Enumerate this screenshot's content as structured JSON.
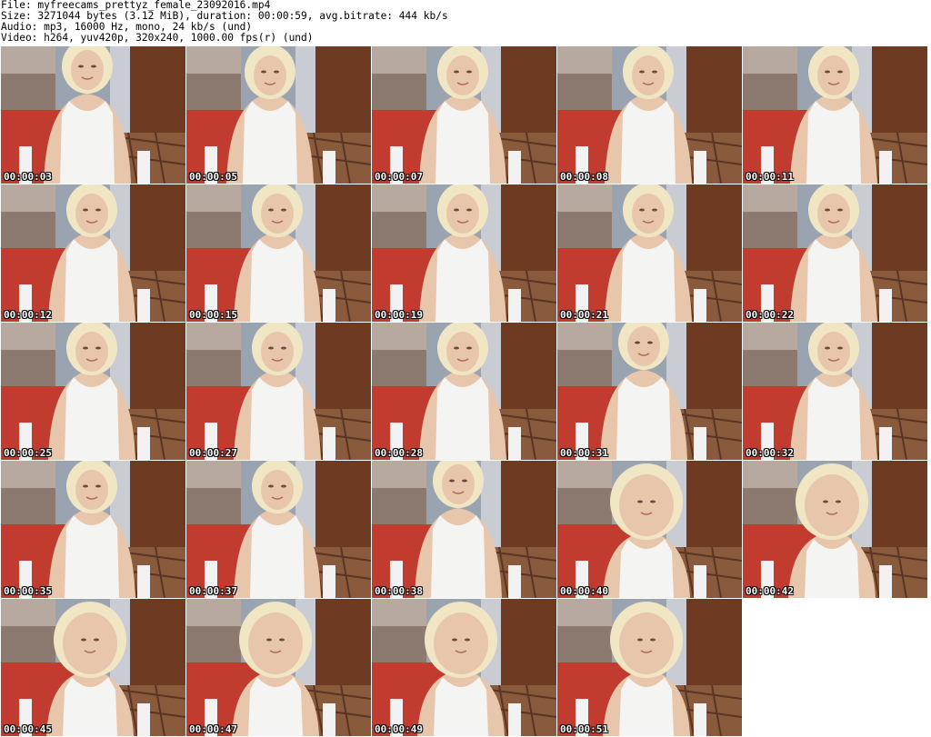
{
  "header": {
    "file": "File: myfreecams_prettyz_female_23092016.mp4",
    "size": "Size: 3271044 bytes (3.12 MiB), duration: 00:00:59, avg.bitrate: 444 kb/s",
    "audio": "Audio: mp3, 16000 Hz, mono, 24 kb/s (und)",
    "video": "Video: h264, yuv420p, 320x240, 1000.00 fps(r) (und)"
  },
  "thumbnails": [
    {
      "timestamp": "00:00:03",
      "pose": "down"
    },
    {
      "timestamp": "00:00:05",
      "pose": "side"
    },
    {
      "timestamp": "00:00:07",
      "pose": "front"
    },
    {
      "timestamp": "00:00:08",
      "pose": "front"
    },
    {
      "timestamp": "00:00:11",
      "pose": "front"
    },
    {
      "timestamp": "00:00:12",
      "pose": "front"
    },
    {
      "timestamp": "00:00:15",
      "pose": "front"
    },
    {
      "timestamp": "00:00:19",
      "pose": "front"
    },
    {
      "timestamp": "00:00:21",
      "pose": "front"
    },
    {
      "timestamp": "00:00:22",
      "pose": "front"
    },
    {
      "timestamp": "00:00:25",
      "pose": "front"
    },
    {
      "timestamp": "00:00:27",
      "pose": "front"
    },
    {
      "timestamp": "00:00:28",
      "pose": "front"
    },
    {
      "timestamp": "00:00:31",
      "pose": "down"
    },
    {
      "timestamp": "00:00:32",
      "pose": "front"
    },
    {
      "timestamp": "00:00:35",
      "pose": "front"
    },
    {
      "timestamp": "00:00:37",
      "pose": "front"
    },
    {
      "timestamp": "00:00:38",
      "pose": "down"
    },
    {
      "timestamp": "00:00:40",
      "pose": "close"
    },
    {
      "timestamp": "00:00:42",
      "pose": "close"
    },
    {
      "timestamp": "00:00:45",
      "pose": "close"
    },
    {
      "timestamp": "00:00:47",
      "pose": "close"
    },
    {
      "timestamp": "00:00:49",
      "pose": "close"
    },
    {
      "timestamp": "00:00:51",
      "pose": "close"
    }
  ],
  "colors": {
    "curtain": "#c13b2e",
    "wall": "#9aa4b0",
    "door": "#6e3a22",
    "carpet": "#8a5a3c",
    "skin": "#e8c6ab",
    "hair": "#f1e6c4",
    "top": "#f4f4f2"
  }
}
